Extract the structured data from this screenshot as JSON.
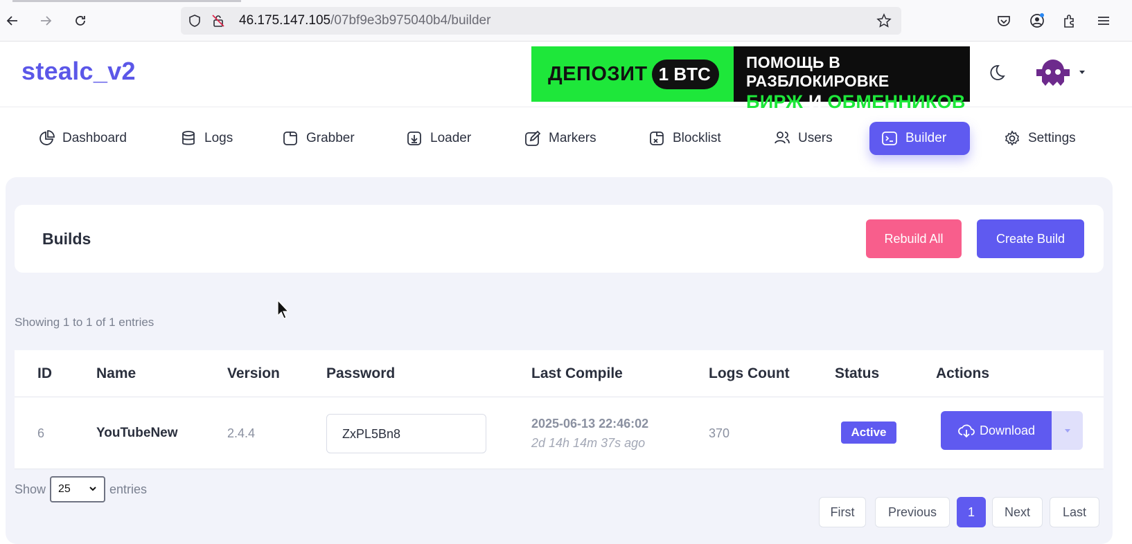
{
  "browser": {
    "url_host": "46.175.147.105",
    "url_path": "/07bf9e3b975040b4/builder"
  },
  "header": {
    "brand": "stealc_v2",
    "banner": {
      "deposit": "ДЕПОЗИТ",
      "btc": "1 BTC",
      "line1": "ПОМОЩЬ В РАЗБЛОКИРОВКЕ",
      "line2_a": "БИРЖ",
      "line2_b": "И",
      "line2_c": "ОБМЕННИКОВ"
    }
  },
  "menu": {
    "items": [
      {
        "label": "Dashboard",
        "icon": "pie-chart-icon"
      },
      {
        "label": "Logs",
        "icon": "database-icon"
      },
      {
        "label": "Grabber",
        "icon": "file-icon"
      },
      {
        "label": "Loader",
        "icon": "download-box-icon"
      },
      {
        "label": "Markers",
        "icon": "edit-icon"
      },
      {
        "label": "Blocklist",
        "icon": "blocked-file-icon"
      },
      {
        "label": "Users",
        "icon": "users-icon"
      },
      {
        "label": "Builder",
        "icon": "terminal-icon"
      },
      {
        "label": "Settings",
        "icon": "gear-icon"
      }
    ],
    "active": "Builder"
  },
  "builds": {
    "title": "Builds",
    "rebuild_label": "Rebuild All",
    "create_label": "Create Build"
  },
  "table": {
    "showing": "Showing 1 to 1 of 1 entries",
    "columns": [
      "ID",
      "Name",
      "Version",
      "Password",
      "Last Compile",
      "Logs Count",
      "Status",
      "Actions"
    ],
    "rows": [
      {
        "id": "6",
        "name": "YouTubeNew",
        "version": "2.4.4",
        "password": "ZxPL5Bn8",
        "last_compile": "2025-06-13 22:46:02",
        "last_compile_ago": "2d 14h 14m 37s ago",
        "logs_count": "370",
        "status": "Active",
        "action": "Download"
      }
    ],
    "show_label": "Show",
    "page_size": "25",
    "entries_label": "entries"
  },
  "pagination": {
    "first": "First",
    "previous": "Previous",
    "current": "1",
    "next": "Next",
    "last": "Last"
  },
  "colors": {
    "accent": "#5f5af0",
    "rebuild": "#f85e8c",
    "banner_green": "#1ee73a"
  }
}
